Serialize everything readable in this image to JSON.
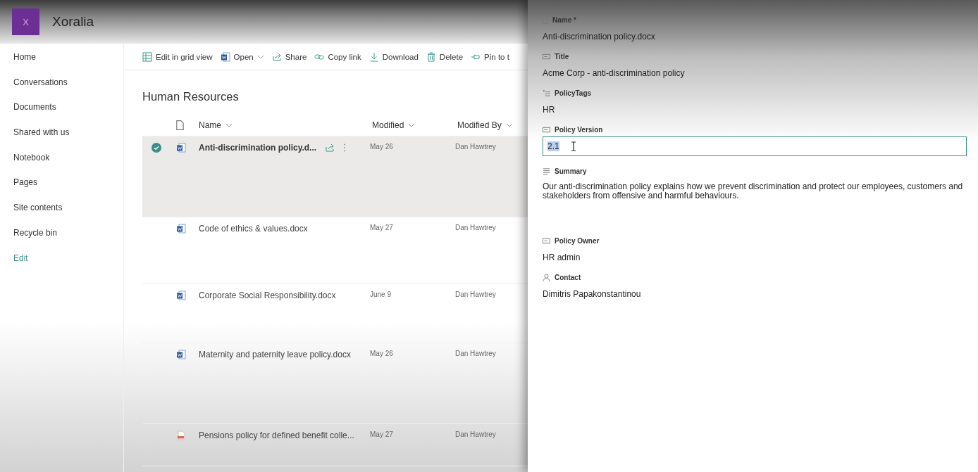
{
  "site": {
    "logo_letter": "X",
    "name": "Xoralia"
  },
  "nav": [
    {
      "label": "Home",
      "kind": "item"
    },
    {
      "label": "Conversations",
      "kind": "item"
    },
    {
      "label": "Documents",
      "kind": "item"
    },
    {
      "label": "Shared with us",
      "kind": "item"
    },
    {
      "label": "Notebook",
      "kind": "item"
    },
    {
      "label": "Pages",
      "kind": "item"
    },
    {
      "label": "Site contents",
      "kind": "item"
    },
    {
      "label": "Recycle bin",
      "kind": "item"
    },
    {
      "label": "Edit",
      "kind": "link"
    }
  ],
  "toolbar": [
    {
      "label": "Edit in grid view",
      "dropdown": false
    },
    {
      "label": "Open",
      "dropdown": true
    },
    {
      "label": "Share",
      "dropdown": false
    },
    {
      "label": "Copy link",
      "dropdown": false
    },
    {
      "label": "Download",
      "dropdown": false
    },
    {
      "label": "Delete",
      "dropdown": false
    },
    {
      "label": "Pin to t",
      "dropdown": false
    }
  ],
  "library": {
    "title": "Human Resources",
    "columns": [
      "Name",
      "Modified",
      "Modified By"
    ],
    "rows": [
      {
        "name": "Anti-discrimination policy.d...",
        "modified": "May 26",
        "modified_by": "Dan Hawtrey",
        "kind": "word",
        "selected": true
      },
      {
        "name": "Code of ethics & values.docx",
        "modified": "May 27",
        "modified_by": "Dan Hawtrey",
        "kind": "word",
        "selected": false
      },
      {
        "name": "Corporate Social Responsibility.docx",
        "modified": "June 9",
        "modified_by": "Dan Hawtrey",
        "kind": "word",
        "selected": false
      },
      {
        "name": "Maternity and paternity leave policy.docx",
        "modified": "May 26",
        "modified_by": "Dan Hawtrey",
        "kind": "word",
        "selected": false
      },
      {
        "name": "Pensions policy for defined benefit colle...",
        "modified": "May 27",
        "modified_by": "Dan Hawtrey",
        "kind": "pdf",
        "selected": false
      }
    ]
  },
  "details_panel": {
    "fields": [
      {
        "label": "Name *",
        "kind": "text",
        "value": "Anti-discrimination policy.docx"
      },
      {
        "label": "Title",
        "kind": "text",
        "value": "Acme Corp - anti-discrimination policy"
      },
      {
        "label": "PolicyTags",
        "kind": "text",
        "value": "HR"
      },
      {
        "label": "Policy Version",
        "kind": "input",
        "value": "2.1"
      },
      {
        "label": "Summary",
        "kind": "multiline",
        "value": "Our anti-discrimination policy explains how we prevent discrimination and protect our employees, customers and stakeholders from offensive and harmful behaviours."
      },
      {
        "label": "Policy Owner",
        "kind": "text",
        "value": "HR admin"
      },
      {
        "label": "Contact",
        "kind": "text",
        "value": "Dimitris Papakonstantinou"
      }
    ]
  }
}
